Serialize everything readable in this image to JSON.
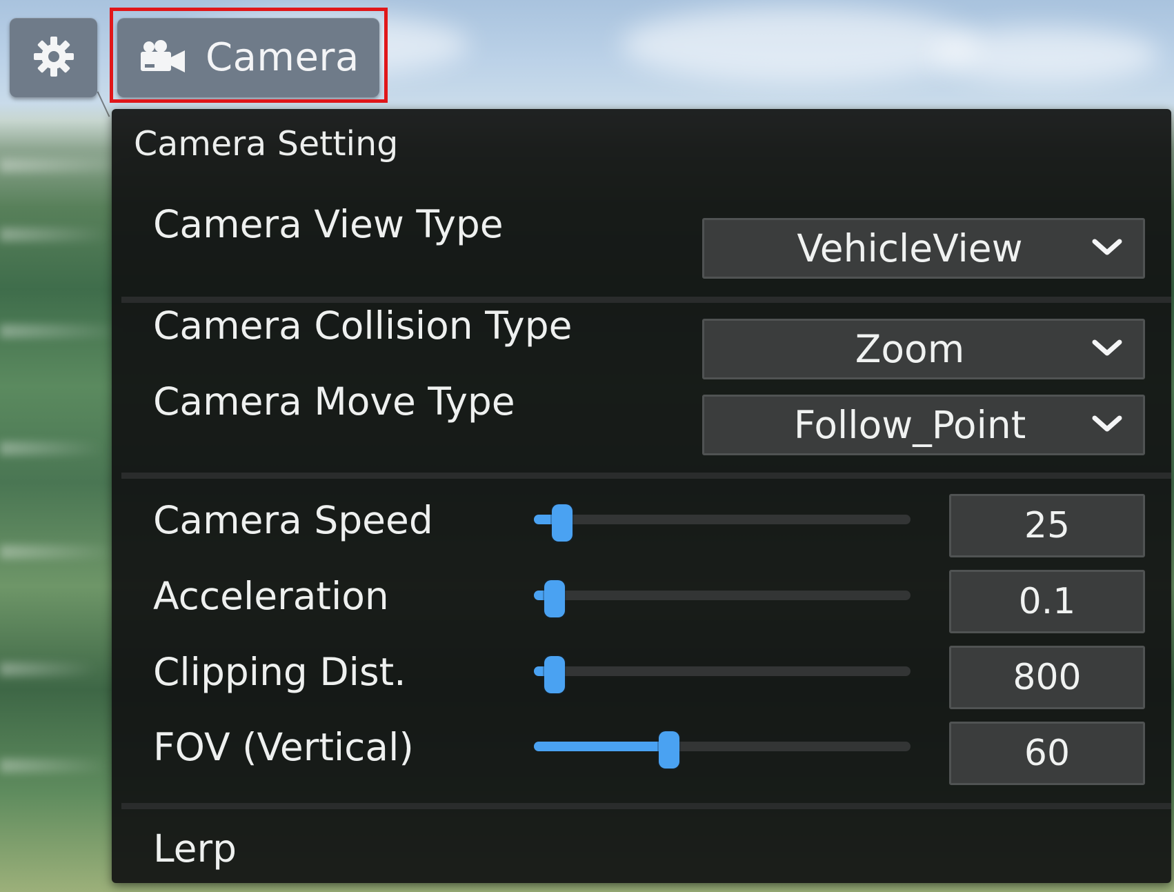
{
  "toolbar": {
    "settings_icon": "gear-icon",
    "camera_icon": "video-camera-icon",
    "camera_label": "Camera"
  },
  "panel": {
    "title": "Camera Setting",
    "dropdowns": [
      {
        "label": "Camera View Type",
        "value": "VehicleView"
      },
      {
        "label": "Camera Collision Type",
        "value": "Zoom"
      },
      {
        "label": "Camera Move Type",
        "value": "Follow_Point"
      }
    ],
    "sliders": [
      {
        "label": "Camera Speed",
        "value": "25",
        "level": 0.05
      },
      {
        "label": "Acceleration",
        "value": "0.1",
        "level": 0.03
      },
      {
        "label": "Clipping Dist.",
        "value": "800",
        "level": 0.03
      },
      {
        "label": "FOV (Vertical)",
        "value": "60",
        "level": 0.35
      }
    ],
    "lerp_label": "Lerp"
  },
  "colors": {
    "accent": "#4aa2f2",
    "highlight": "#e0171a",
    "panel_bg": "#121313",
    "field_bg": "#3b3d3d",
    "toolbar_button": "#6f7b89"
  }
}
